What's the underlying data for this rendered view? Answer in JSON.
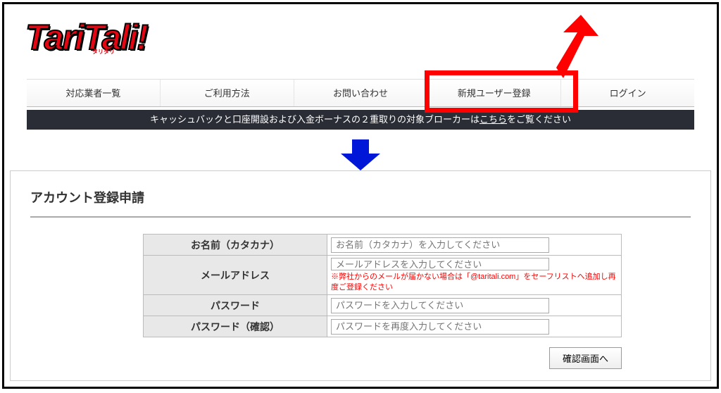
{
  "logo": {
    "text": "TariTali!",
    "subtext": "タリタリ"
  },
  "nav": {
    "items": [
      "対応業者一覧",
      "ご利用方法",
      "お問い合わせ",
      "新規ユーザー登録",
      "ログイン"
    ]
  },
  "banner": {
    "prefix": "キャッシュバックと口座開設および入金ボーナスの２重取りの対象ブローカーは",
    "link": "こちら",
    "suffix": "をご覧ください"
  },
  "form": {
    "title": "アカウント登録申請",
    "fields": {
      "name": {
        "label": "お名前（カタカナ）",
        "placeholder": "お名前（カタカナ）を入力してください"
      },
      "email": {
        "label": "メールアドレス",
        "placeholder": "メールアドレスを入力してください",
        "note": "※弊社からのメールが届かない場合は「@taritali.com」をセーフリストへ追加し再度ご登録ください"
      },
      "password": {
        "label": "パスワード",
        "placeholder": "パスワードを入力してください"
      },
      "password_confirm": {
        "label": "パスワード（確認）",
        "placeholder": "パスワードを再度入力してください"
      }
    },
    "submit": "確認画面へ"
  }
}
